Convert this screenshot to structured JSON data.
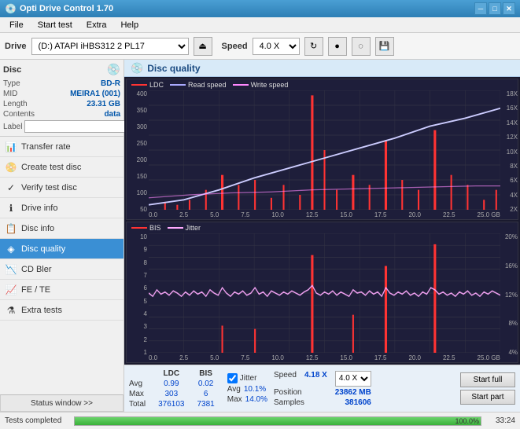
{
  "titleBar": {
    "title": "Opti Drive Control 1.70",
    "icon": "💿",
    "minBtn": "─",
    "maxBtn": "□",
    "closeBtn": "✕"
  },
  "menuBar": {
    "items": [
      "File",
      "Start test",
      "Extra",
      "Help"
    ]
  },
  "toolbar": {
    "driveLabel": "Drive",
    "driveValue": "(D:)  ATAPI iHBS312  2 PL17",
    "ejectIcon": "⏏",
    "speedLabel": "Speed",
    "speedValue": "4.0 X",
    "rotateIcon": "↻",
    "burnIcon": "●",
    "eraseIcon": "◌",
    "saveIcon": "💾"
  },
  "discSection": {
    "title": "Disc",
    "iconDisc": "💿",
    "rows": [
      {
        "key": "Type",
        "val": "BD-R"
      },
      {
        "key": "MID",
        "val": "MEIRA1 (001)"
      },
      {
        "key": "Length",
        "val": "23.31 GB"
      },
      {
        "key": "Contents",
        "val": "data"
      }
    ],
    "labelKey": "Label",
    "labelPlaceholder": "",
    "labelBtnIcon": "🔍"
  },
  "navItems": [
    {
      "id": "transfer-rate",
      "label": "Transfer rate",
      "icon": "📊",
      "active": false
    },
    {
      "id": "create-test-disc",
      "label": "Create test disc",
      "icon": "📀",
      "active": false
    },
    {
      "id": "verify-test-disc",
      "label": "Verify test disc",
      "icon": "✓",
      "active": false
    },
    {
      "id": "drive-info",
      "label": "Drive info",
      "icon": "ℹ",
      "active": false
    },
    {
      "id": "disc-info",
      "label": "Disc info",
      "icon": "📋",
      "active": false
    },
    {
      "id": "disc-quality",
      "label": "Disc quality",
      "icon": "◈",
      "active": true
    },
    {
      "id": "cd-bler",
      "label": "CD Bler",
      "icon": "📉",
      "active": false
    },
    {
      "id": "fe-te",
      "label": "FE / TE",
      "icon": "📈",
      "active": false
    },
    {
      "id": "extra-tests",
      "label": "Extra tests",
      "icon": "⚗",
      "active": false
    }
  ],
  "statusWindow": "Status window >>",
  "discQuality": {
    "title": "Disc quality",
    "iconColor": "#3a7fc4",
    "legend": {
      "ldc": {
        "label": "LDC",
        "color": "#ff4444"
      },
      "readSpeed": {
        "label": "Read speed",
        "color": "#aaaaff"
      },
      "writeSpeed": {
        "label": "Write speed",
        "color": "#ff88ff"
      }
    },
    "legend2": {
      "bis": {
        "label": "BIS",
        "color": "#ff4444"
      },
      "jitter": {
        "label": "Jitter",
        "color": "#ffaaff"
      }
    },
    "upperYLeft": [
      "400",
      "350",
      "300",
      "250",
      "200",
      "150",
      "100",
      "50"
    ],
    "upperYRight": [
      "18X",
      "16X",
      "14X",
      "12X",
      "10X",
      "8X",
      "6X",
      "4X",
      "2X"
    ],
    "lowerYLeft": [
      "10",
      "9",
      "8",
      "7",
      "6",
      "5",
      "4",
      "3",
      "2",
      "1"
    ],
    "lowerYRight": [
      "20%",
      "16%",
      "12%",
      "8%",
      "4%"
    ],
    "xLabels": [
      "0.0",
      "2.5",
      "5.0",
      "7.5",
      "10.0",
      "12.5",
      "15.0",
      "17.5",
      "20.0",
      "22.5",
      "25.0 GB"
    ]
  },
  "stats": {
    "headers": [
      "",
      "LDC",
      "BIS",
      "",
      "Jitter",
      "Speed"
    ],
    "rows": [
      {
        "label": "Avg",
        "ldc": "0.99",
        "bis": "0.02",
        "jitter": "10.1%",
        "speed": "4.18 X"
      },
      {
        "label": "Max",
        "ldc": "303",
        "bis": "6",
        "jitter": "14.0%",
        "position": "23862 MB"
      },
      {
        "label": "Total",
        "ldc": "376103",
        "bis": "7381",
        "samples": "381606"
      }
    ],
    "jitterChecked": true,
    "jitterLabel": "Jitter",
    "speedLabel": "Speed",
    "speedVal": "4.18 X",
    "speedDropdown": "4.0 X",
    "posLabel": "Position",
    "posVal": "23862 MB",
    "samplesLabel": "Samples",
    "samplesVal": "381606"
  },
  "actionBtns": {
    "startFull": "Start full",
    "startPart": "Start part"
  },
  "bottomBar": {
    "status": "Tests completed",
    "progress": 100,
    "progressText": "100.0%",
    "time": "33:24"
  }
}
